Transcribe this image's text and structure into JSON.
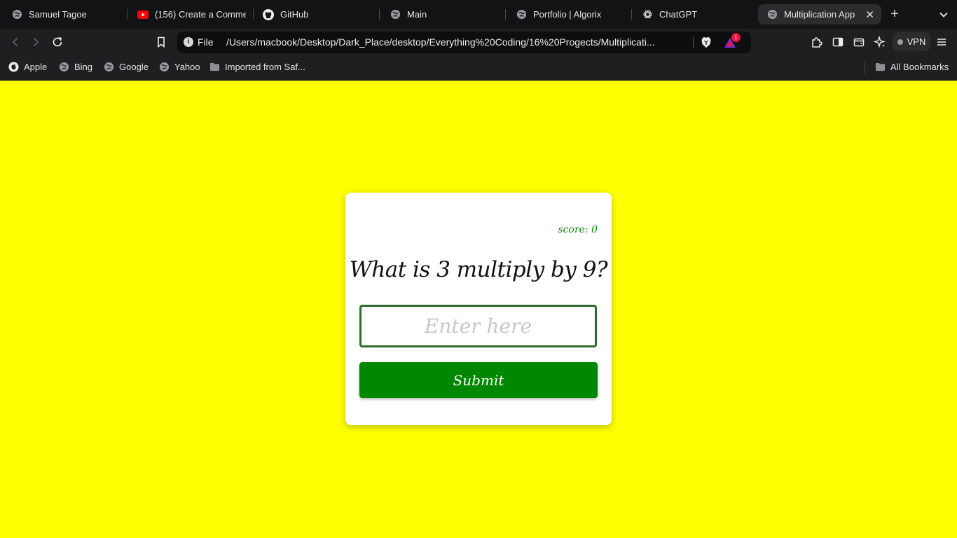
{
  "tabs": [
    {
      "title": "Samuel Tagoe",
      "icon": "globe-icon"
    },
    {
      "title": "(156) Create a Commen",
      "icon": "youtube-icon"
    },
    {
      "title": "GitHub",
      "icon": "github-icon"
    },
    {
      "title": "Main",
      "icon": "globe-icon"
    },
    {
      "title": "Portfolio | Algorix",
      "icon": "globe-icon"
    },
    {
      "title": "ChatGPT",
      "icon": "chatgpt-icon"
    },
    {
      "title": "Multiplication App",
      "icon": "globe-icon",
      "active": true
    }
  ],
  "omnibox": {
    "scheme_label": "File",
    "url": "/Users/macbook/Desktop/Dark_Place/desktop/Everything%20Coding/16%20Progects/Multiplicati...",
    "rewards_badge": "1"
  },
  "toolbar": {
    "vpn_label": "VPN"
  },
  "bookmarks": [
    {
      "label": "Apple",
      "icon": "apple-icon"
    },
    {
      "label": "Bing",
      "icon": "globe-icon"
    },
    {
      "label": "Google",
      "icon": "globe-icon"
    },
    {
      "label": "Yahoo",
      "icon": "globe-icon"
    },
    {
      "label": "Imported from Saf...",
      "icon": "folder-icon"
    }
  ],
  "all_bookmarks_label": "All Bookmarks",
  "app": {
    "score_text": "score: 0",
    "question": "What is 3 multiply by 9?",
    "input_placeholder": "Enter here",
    "input_value": "",
    "submit_label": "Submit"
  },
  "colors": {
    "page_background": "#ffff00",
    "card_background": "#ffffff",
    "submit_button": "#008700",
    "score_text": "#0a8a0a",
    "input_border": "#2f6b2f"
  }
}
